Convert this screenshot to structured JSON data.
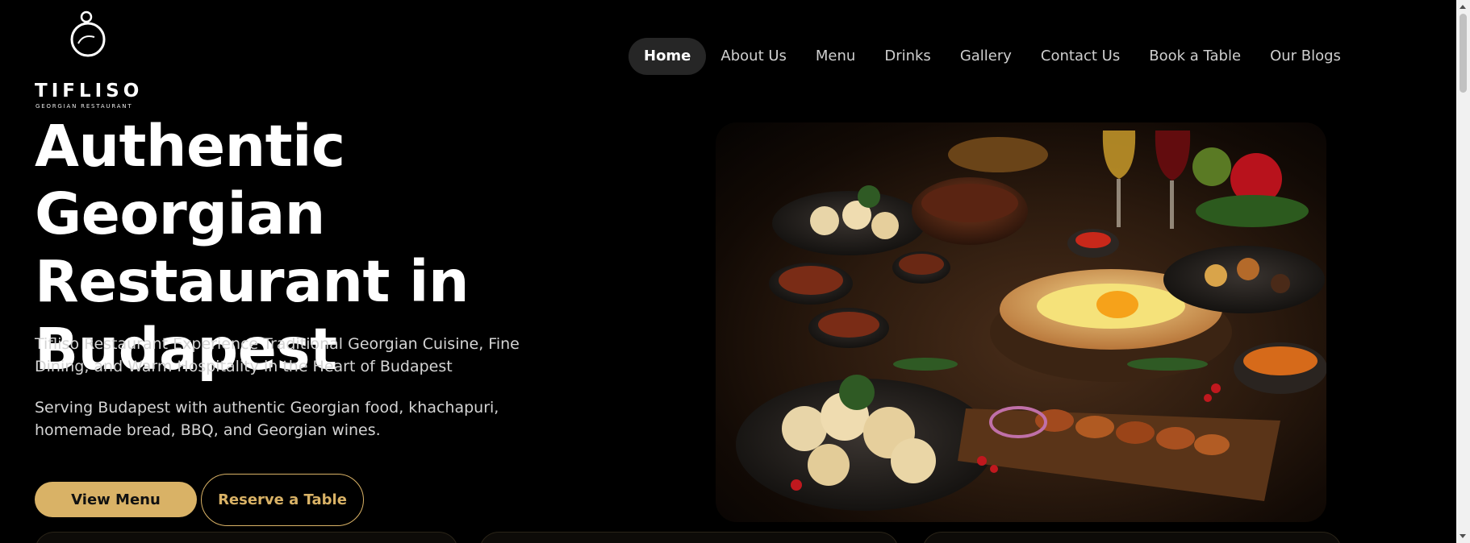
{
  "logo": {
    "icon": "logo-bottle-icon",
    "brand": "TIFLISO",
    "tagline": "GEORGIAN RESTAURANT"
  },
  "nav": {
    "items": [
      {
        "label": "Home",
        "active": true
      },
      {
        "label": "About Us",
        "active": false
      },
      {
        "label": "Menu",
        "active": false
      },
      {
        "label": "Drinks",
        "active": false
      },
      {
        "label": "Gallery",
        "active": false
      },
      {
        "label": "Contact Us",
        "active": false
      },
      {
        "label": "Book a Table",
        "active": false
      },
      {
        "label": "Our Blogs",
        "active": false
      }
    ]
  },
  "hero": {
    "title": "Authentic Georgian Restaurant in Budapest",
    "subtitle": "Tifliso Restaurant Experience Traditional Georgian Cuisine, Fine Dining, and Warm Hospitality in the Heart of Budapest",
    "description": "Serving Budapest with authentic Georgian food, khachapuri, homemade bread, BBQ, and Georgian wines.",
    "primary_button": "View Menu",
    "secondary_button": "Reserve a Table"
  },
  "colors": {
    "background": "#000000",
    "accent": "#d9b266",
    "nav_active_bg": "#262626"
  }
}
